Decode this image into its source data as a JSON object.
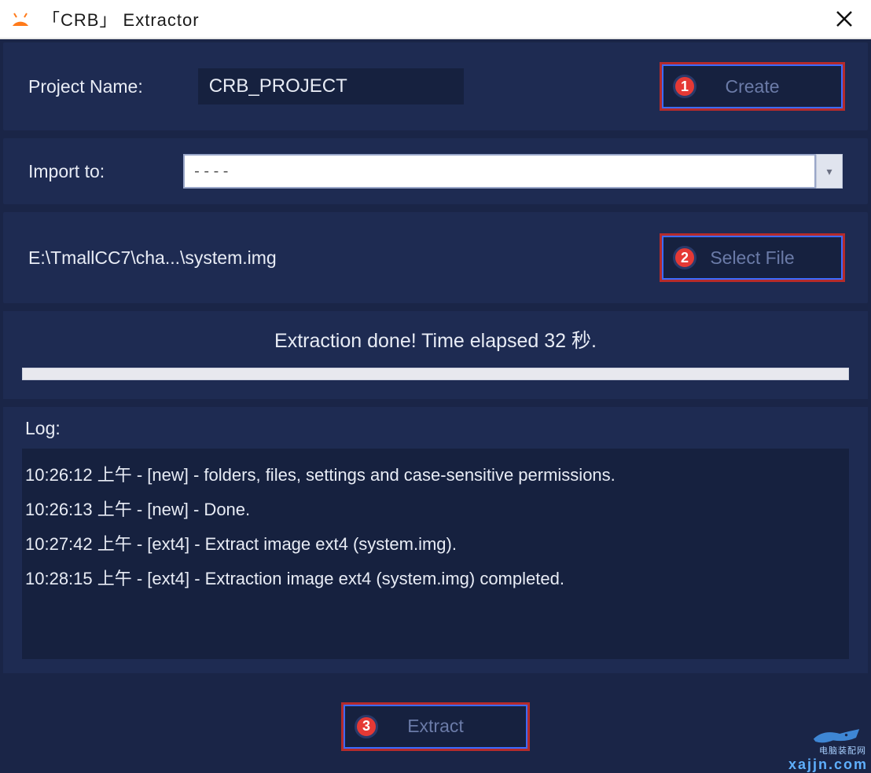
{
  "titlebar": {
    "title": "「CRB」 Extractor"
  },
  "project": {
    "label": "Project Name:",
    "value": "CRB_PROJECT",
    "create_label": "Create",
    "create_badge": "1"
  },
  "import": {
    "label": "Import to:",
    "value": "- - - -"
  },
  "file": {
    "path": "E:\\TmallCC7\\cha...\\system.img",
    "select_label": "Select File",
    "select_badge": "2"
  },
  "status": {
    "text": "Extraction done! Time elapsed 32 秒."
  },
  "log": {
    "label": "Log:",
    "lines": [
      "10:26:12 上午 - [new] - folders, files, settings and case-sensitive permissions.",
      "10:26:13 上午 - [new] - Done.",
      "10:27:42 上午 - [ext4] - Extract image ext4 (system.img).",
      "10:28:15 上午 - [ext4] - Extraction image ext4 (system.img) completed."
    ]
  },
  "extract": {
    "label": "Extract",
    "badge": "3"
  },
  "watermark": {
    "line1": "电脑装配网",
    "line2": "xajjn.com"
  }
}
